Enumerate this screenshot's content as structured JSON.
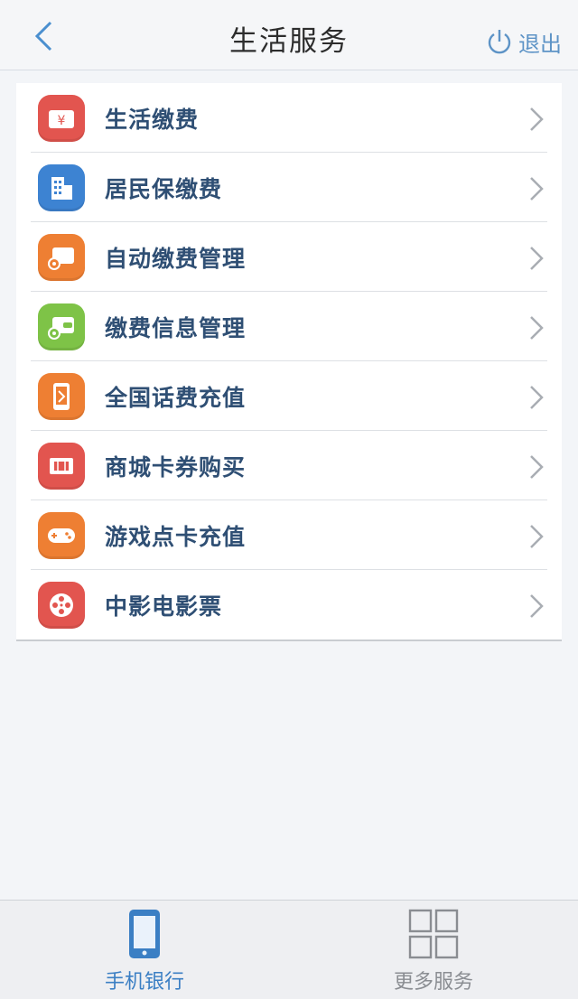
{
  "header": {
    "title": "生活服务",
    "back_icon": "chevron-left-icon",
    "logout_label": "退出",
    "logout_icon": "power-icon"
  },
  "menu": {
    "items": [
      {
        "label": "生活缴费",
        "icon": "wallet-yen-icon",
        "color": "#e2554f"
      },
      {
        "label": "居民保缴费",
        "icon": "building-icon",
        "color": "#3d83d2"
      },
      {
        "label": "自动缴费管理",
        "icon": "wallet-gear-icon",
        "color": "#ee7f33"
      },
      {
        "label": "缴费信息管理",
        "icon": "wallet-info-icon",
        "color": "#7ec347"
      },
      {
        "label": "全国话费充值",
        "icon": "phone-recharge-icon",
        "color": "#ee7f33"
      },
      {
        "label": "商城卡券购买",
        "icon": "ticket-icon",
        "color": "#e2554f"
      },
      {
        "label": "游戏点卡充值",
        "icon": "gamepad-icon",
        "color": "#ee7f33"
      },
      {
        "label": "中影电影票",
        "icon": "film-reel-icon",
        "color": "#e2554f"
      }
    ]
  },
  "tabbar": {
    "tabs": [
      {
        "label": "手机银行",
        "icon": "mobile-phone-icon",
        "active": true,
        "color": "#3b7fc4"
      },
      {
        "label": "更多服务",
        "icon": "grid-icon",
        "active": false,
        "color": "#8a8d92"
      }
    ]
  }
}
